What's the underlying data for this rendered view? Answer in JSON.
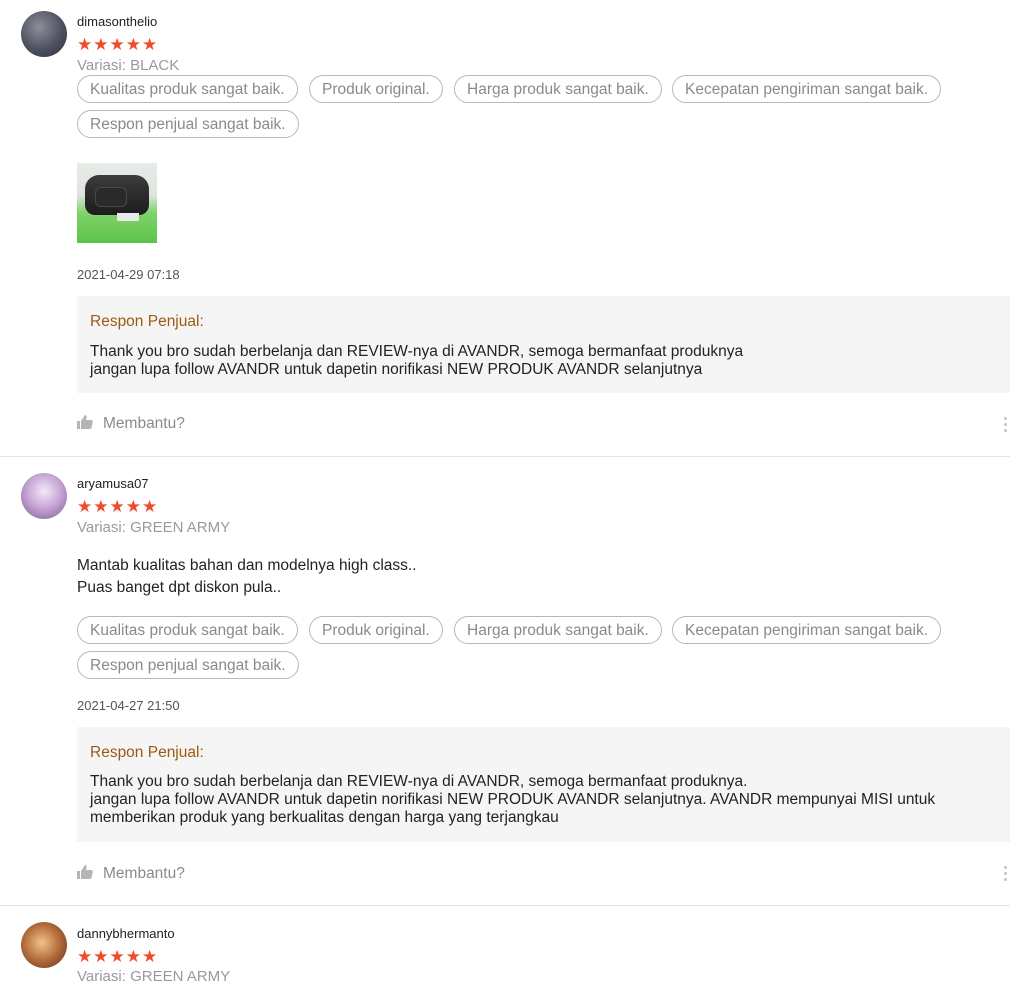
{
  "reviews": [
    {
      "username": "dimasonthelio",
      "stars": "★★★★★",
      "rating": 5,
      "variant": "Variasi: BLACK",
      "comment": "",
      "tags": [
        "Kualitas produk sangat baik.",
        "Produk original.",
        "Harga produk sangat baik.",
        "Kecepatan pengiriman sangat baik.",
        "Respon penjual sangat baik."
      ],
      "date": "2021-04-29 07:18",
      "reply_title": "Respon Penjual:",
      "reply_text": "Thank you bro sudah berbelanja dan REVIEW-nya di AVANDR, semoga bermanfaat produknya\njangan lupa follow AVANDR untuk dapetin norifikasi NEW PRODUK AVANDR selanjutnya",
      "helpful": "Membantu?"
    },
    {
      "username": "aryamusa07",
      "stars": "★★★★★",
      "rating": 5,
      "variant": "Variasi: GREEN ARMY",
      "comment_lines": [
        "Mantab kualitas bahan dan modelnya high class..",
        "Puas banget dpt diskon pula.."
      ],
      "tags": [
        "Kualitas produk sangat baik.",
        "Produk original.",
        "Harga produk sangat baik.",
        "Kecepatan pengiriman sangat baik.",
        "Respon penjual sangat baik."
      ],
      "date": "2021-04-27 21:50",
      "reply_title": "Respon Penjual:",
      "reply_text": "Thank you bro sudah berbelanja dan REVIEW-nya di AVANDR, semoga bermanfaat produknya.\njangan lupa follow AVANDR untuk dapetin norifikasi NEW PRODUK AVANDR selanjutnya. AVANDR mempunyai MISI untuk\nmemberikan produk yang berkualitas dengan harga yang terjangkau",
      "helpful": "Membantu?"
    },
    {
      "username": "dannybhermanto",
      "stars": "★★★★★",
      "rating": 5,
      "variant": "Variasi: GREEN ARMY"
    }
  ]
}
